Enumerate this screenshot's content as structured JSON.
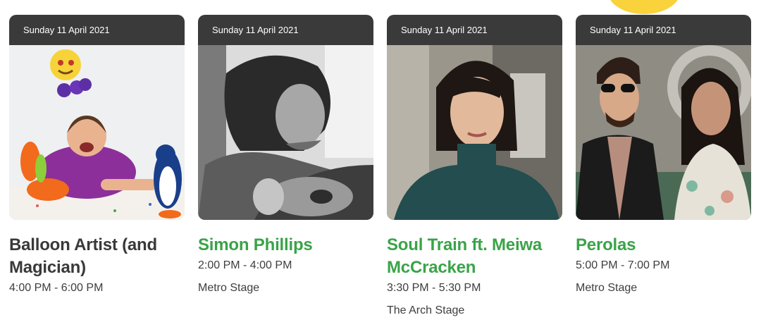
{
  "events": [
    {
      "date": "Sunday 11 April 2021",
      "title": "Balloon Artist (and Magician)",
      "title_color": "#3a3838",
      "time": "4:00 PM - 6:00 PM",
      "stage": ""
    },
    {
      "date": "Sunday 11 April 2021",
      "title": "Simon Phillips",
      "title_color": "#3aa348",
      "time": "2:00 PM - 4:00 PM",
      "stage": "Metro Stage"
    },
    {
      "date": "Sunday 11 April 2021",
      "title": "Soul Train ft. Meiwa McCracken",
      "title_color": "#3aa348",
      "time": "3:30 PM - 5:30 PM",
      "stage": "The Arch Stage"
    },
    {
      "date": "Sunday 11 April 2021",
      "title": "Perolas",
      "title_color": "#3aa348",
      "time": "5:00 PM - 7:00 PM",
      "stage": "Metro Stage"
    }
  ],
  "colors": {
    "date_bar": "#3b3a3a",
    "green_link": "#3aa348",
    "accent_sun": "#f9d23c"
  }
}
